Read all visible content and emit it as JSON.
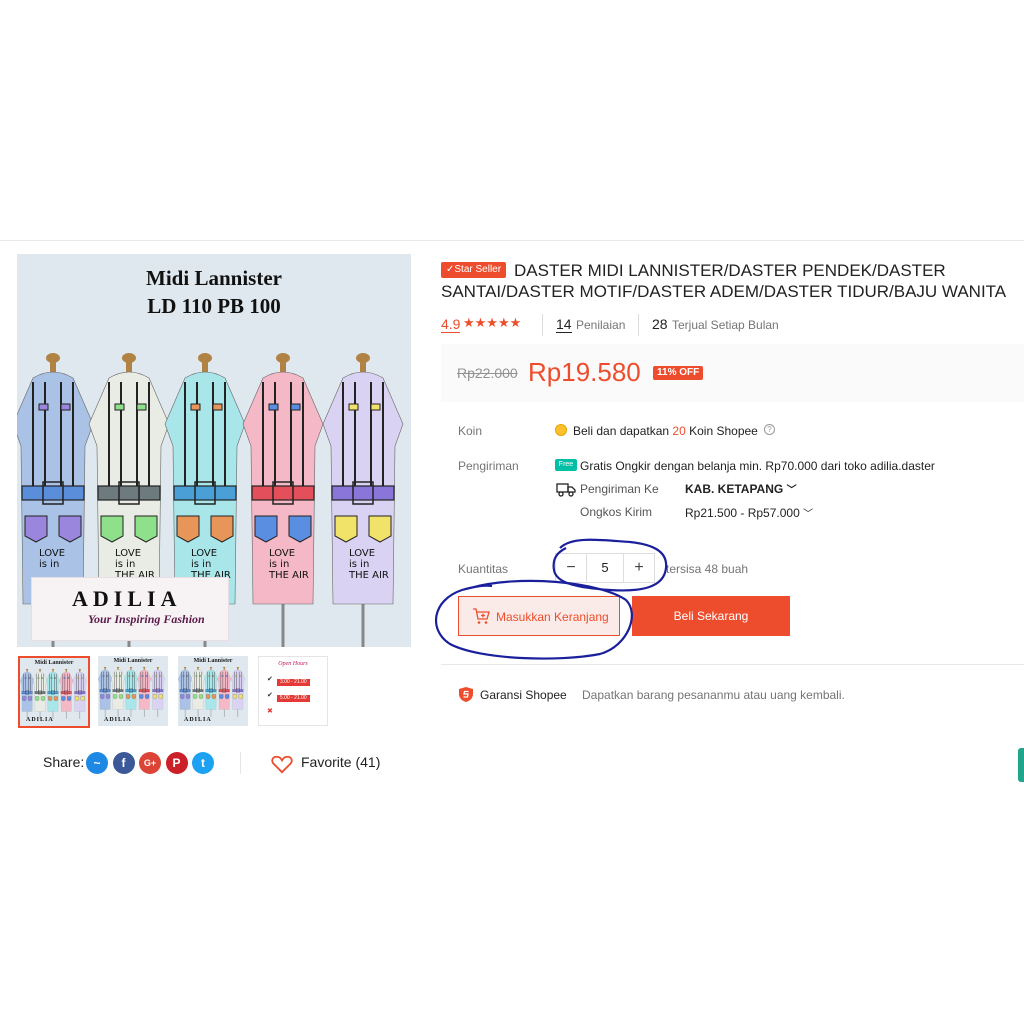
{
  "product": {
    "badge": "Star Seller",
    "title": "DASTER MIDI LANNISTER/DASTER PENDEK/DASTER SANTAI/DASTER MOTIF/DASTER ADEM/DASTER TIDUR/BAJU WANITA",
    "rating": "4.9",
    "stars": "★★★★★",
    "reviews_count": "14",
    "reviews_label": "Penilaian",
    "sold_count": "28",
    "sold_label": "Terjual Setiap Bulan",
    "old_price": "Rp22.000",
    "price": "Rp19.580",
    "discount": "11% OFF"
  },
  "image": {
    "line1": "Midi Lannister",
    "line2": "LD 110 PB 100",
    "brand": "ADILIA",
    "tagline": "Your Inspiring Fashion",
    "thumb_title": "Midi Lannister",
    "thumb_sub": "LD 110 PB 100",
    "thumb_brand": "ADILIA",
    "thumb4_title": "Open Hours",
    "thumb4_b1": "3.00 - 21.00",
    "thumb4_b2": "5.00 - 21.00",
    "dress_texts": [
      [
        "LOVE",
        "is in"
      ],
      [
        "LOVE",
        "is in",
        "THE AIR"
      ],
      [
        "LOVE",
        "is in",
        "THE AIR"
      ],
      [
        "LOVE",
        "is in",
        "THE AIR"
      ],
      [
        "LOVE",
        "is in",
        "THE AIR"
      ]
    ],
    "dress_colors": [
      "#a9c2e6",
      "#e9ece4",
      "#a8e6ea",
      "#f4b8c6",
      "#d9d2f2"
    ],
    "pocket_colors": [
      "#9a86dc",
      "#8fe08a",
      "#e8955a",
      "#5a8ee0",
      "#f1e36a"
    ],
    "belt_colors": [
      "#5a8edb",
      "#6d7b7e",
      "#4aa0d6",
      "#e3505b",
      "#8a76d8"
    ]
  },
  "share": {
    "label": "Share:",
    "networks": [
      {
        "name": "messenger",
        "glyph": "~",
        "color": "#1e88e5"
      },
      {
        "name": "facebook",
        "glyph": "f",
        "color": "#3b5998"
      },
      {
        "name": "google-plus",
        "glyph": "G+",
        "color": "#db4437"
      },
      {
        "name": "pinterest",
        "glyph": "P",
        "color": "#cb2027"
      },
      {
        "name": "twitter",
        "glyph": "t",
        "color": "#1da1f2"
      }
    ],
    "favorite_label": "Favorite (41)"
  },
  "details": {
    "koin_label": "Koin",
    "koin_text_a": "Beli dan dapatkan",
    "koin_amount": "20",
    "koin_text_b": "Koin Shopee",
    "pengiriman_label": "Pengiriman",
    "free_tag": "Free",
    "free_shipping": "Gratis Ongkir dengan belanja min. Rp70.000 dari toko adilia.daster",
    "ship_to_label": "Pengiriman Ke",
    "ship_to_value": "KAB. KETAPANG",
    "cost_label": "Ongkos Kirim",
    "cost_value": "Rp21.500 - Rp57.000"
  },
  "quantity": {
    "label": "Kuantitas",
    "value": "5",
    "minus": "−",
    "plus": "+",
    "stock": "tersisa 48 buah"
  },
  "actions": {
    "add_to_cart": "Masukkan Keranjang",
    "buy_now": "Beli Sekarang"
  },
  "guarantee": {
    "label": "Garansi Shopee",
    "text": "Dapatkan barang pesananmu atau uang kembali."
  },
  "colors": {
    "accent": "#ee4d2d",
    "annotation": "#1a1f9c"
  }
}
